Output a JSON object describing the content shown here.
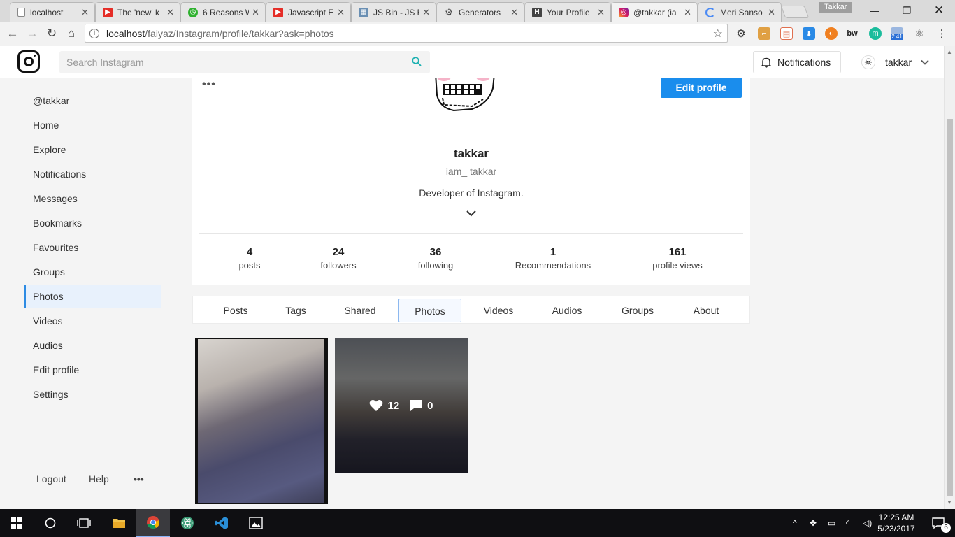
{
  "browser": {
    "tabs": [
      {
        "title": "localhost",
        "favicon": "page-icon"
      },
      {
        "title": "The 'new' k",
        "favicon": "youtube-icon"
      },
      {
        "title": "6 Reasons W",
        "favicon": "clock-icon"
      },
      {
        "title": "Javascript E",
        "favicon": "youtube-icon"
      },
      {
        "title": "JS Bin - JS B",
        "favicon": "jsbin-icon"
      },
      {
        "title": "Generators",
        "favicon": "gear-icon"
      },
      {
        "title": "Your Profile",
        "favicon": "h-icon"
      },
      {
        "title": "@takkar (ia",
        "favicon": "instagram-icon"
      },
      {
        "title": "Meri Sanso",
        "favicon": "loading-icon"
      }
    ],
    "profile_chip": "Takkar",
    "url_host": "localhost",
    "url_path": "/faiyaz/Instagram/profile/takkar?ask=photos",
    "extension_badge": "2.41"
  },
  "topnav": {
    "search_placeholder": "Search Instagram",
    "notifications_label": "Notifications",
    "username": "takkar"
  },
  "sidebar": {
    "items": [
      {
        "label": "@takkar"
      },
      {
        "label": "Home"
      },
      {
        "label": "Explore"
      },
      {
        "label": "Notifications"
      },
      {
        "label": "Messages"
      },
      {
        "label": "Bookmarks"
      },
      {
        "label": "Favourites"
      },
      {
        "label": "Groups"
      },
      {
        "label": "Photos",
        "active": true
      },
      {
        "label": "Videos"
      },
      {
        "label": "Audios"
      },
      {
        "label": "Edit profile"
      },
      {
        "label": "Settings"
      }
    ],
    "footer": {
      "logout": "Logout",
      "help": "Help",
      "more": "•••"
    }
  },
  "profile": {
    "more": "•••",
    "edit_label": "Edit profile",
    "name": "takkar",
    "username": "iam_ takkar",
    "bio": "Developer of Instagram.",
    "stats": [
      {
        "value": "4",
        "label": "posts"
      },
      {
        "value": "24",
        "label": "followers"
      },
      {
        "value": "36",
        "label": "following"
      },
      {
        "value": "1",
        "label": "Recommendations"
      },
      {
        "value": "161",
        "label": "profile views"
      }
    ]
  },
  "tabs": [
    {
      "label": "Posts"
    },
    {
      "label": "Tags"
    },
    {
      "label": "Shared"
    },
    {
      "label": "Photos",
      "active": true
    },
    {
      "label": "Videos"
    },
    {
      "label": "Audios"
    },
    {
      "label": "Groups"
    },
    {
      "label": "About"
    }
  ],
  "photos": [
    {
      "likes": "",
      "comments": ""
    },
    {
      "likes": "12",
      "comments": "0"
    }
  ],
  "taskbar": {
    "time": "12:25 AM",
    "date": "5/23/2017",
    "notification_count": "6"
  },
  "colors": {
    "accent": "#1a8ded",
    "active_bg": "#e8f1fc",
    "active_border": "#2d8be3"
  }
}
